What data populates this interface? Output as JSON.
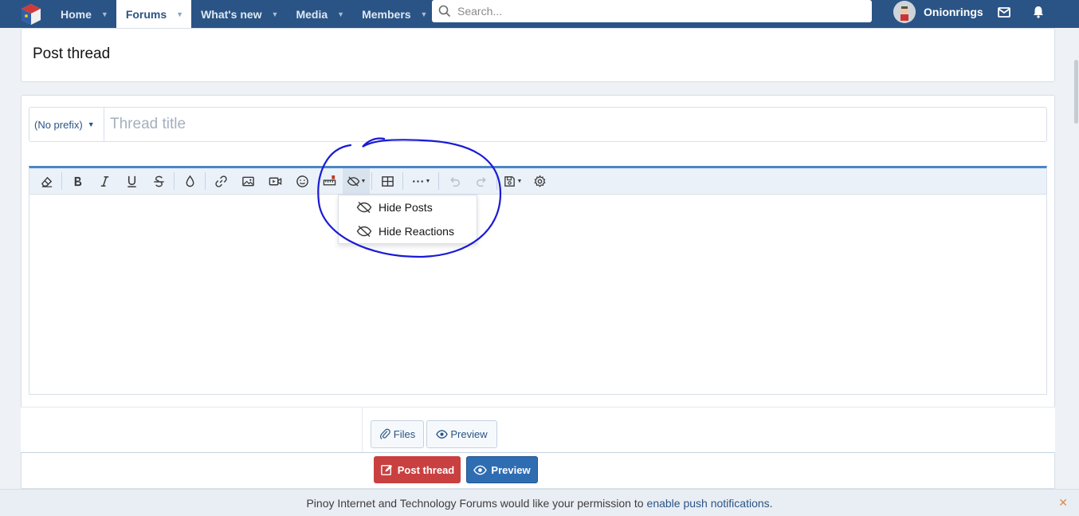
{
  "nav": {
    "tabs": [
      {
        "label": "Home"
      },
      {
        "label": "Forums"
      },
      {
        "label": "What's new"
      },
      {
        "label": "Media"
      },
      {
        "label": "Members"
      }
    ],
    "search_placeholder": "Search...",
    "username": "Onionrings"
  },
  "page": {
    "title": "Post thread",
    "prefix": "(No prefix)",
    "thread_title_placeholder": "Thread title"
  },
  "toolbar": {
    "buttons": [
      "eraser-icon",
      "bold-icon",
      "italic-icon",
      "underline-icon",
      "strikethrough-icon",
      "color-drop-icon",
      "link-icon",
      "image-icon",
      "video-icon",
      "smiley-icon",
      "ruler-icon",
      "hide-icon",
      "table-icon",
      "more-icon",
      "undo-icon",
      "redo-icon",
      "drafts-icon",
      "settings-icon"
    ]
  },
  "hide_menu": {
    "items": [
      {
        "label": "Hide Posts"
      },
      {
        "label": "Hide Reactions"
      }
    ]
  },
  "attach": {
    "files_label": "Files",
    "preview_label": "Preview"
  },
  "submit": {
    "post_label": "Post thread",
    "preview_label": "Preview"
  },
  "notice": {
    "text": "Pinoy Internet and Technology Forums would like your permission to",
    "link": "enable push notifications",
    "end": "."
  },
  "colors": {
    "nav_bg": "#2a5485",
    "accent": "#4a86c5",
    "post_button": "#c94040",
    "preview_button": "#2f6db3",
    "annotation": "#1a1ad6"
  }
}
